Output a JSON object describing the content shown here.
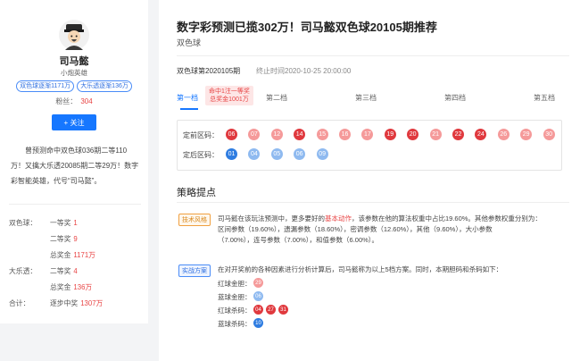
{
  "expert": {
    "name": "司马懿",
    "title": "小炮英雄",
    "tags": [
      "双色球逐渐1171万",
      "大乐透逐渐136万"
    ],
    "fans_label": "粉丝：",
    "fans_count": "304",
    "follow_label": "+ 关注",
    "bio": "曾预测命中双色球036期二等110万！又擒大乐透20085期二等29万！数字彩智能英雄，代号“司马懿”。",
    "stats": [
      {
        "lottery": "双色球：",
        "item": "一等奖",
        "value": "1"
      },
      {
        "lottery": "",
        "item": "二等奖",
        "value": "9"
      },
      {
        "lottery": "",
        "item": "总奖金",
        "value": "1171万"
      },
      {
        "lottery": "大乐透：",
        "item": "二等奖",
        "value": "4"
      },
      {
        "lottery": "",
        "item": "总奖金",
        "value": "136万"
      },
      {
        "lottery": "合计：",
        "item": "逐步中奖",
        "value": "1307万"
      }
    ]
  },
  "header": {
    "title": "数字彩预测已揽302万！司马懿双色球20105期推荐",
    "subtitle": "双色球",
    "period": "双色球第2020105期",
    "end_time": "终止时间2020-10-25 20:00:00"
  },
  "tabs": [
    {
      "label": "第一档",
      "active": true
    },
    {
      "label": "第二档",
      "active": false
    },
    {
      "label": "第三档",
      "active": false
    },
    {
      "label": "第四档",
      "active": false
    },
    {
      "label": "第五档",
      "active": false
    }
  ],
  "badge": {
    "line1": "命中1注一等奖",
    "line2": "总奖金1001万"
  },
  "front_zone": {
    "label": "定前区码：",
    "balls": [
      {
        "n": "06",
        "strong": true
      },
      {
        "n": "07",
        "strong": false
      },
      {
        "n": "12",
        "strong": false
      },
      {
        "n": "14",
        "strong": true
      },
      {
        "n": "15",
        "strong": false
      },
      {
        "n": "16",
        "strong": false
      },
      {
        "n": "17",
        "strong": false
      },
      {
        "n": "19",
        "strong": true
      },
      {
        "n": "20",
        "strong": true
      },
      {
        "n": "21",
        "strong": false
      },
      {
        "n": "22",
        "strong": true
      },
      {
        "n": "24",
        "strong": true
      },
      {
        "n": "26",
        "strong": false
      },
      {
        "n": "29",
        "strong": false
      },
      {
        "n": "30",
        "strong": false
      }
    ]
  },
  "back_zone": {
    "label": "定后区码：",
    "balls": [
      {
        "n": "01",
        "strong": true
      },
      {
        "n": "04",
        "strong": false
      },
      {
        "n": "05",
        "strong": false
      },
      {
        "n": "06",
        "strong": false
      },
      {
        "n": "09",
        "strong": false
      }
    ]
  },
  "strategy": {
    "heading": "策略提点",
    "style_tag": "技术风格",
    "style_lines": [
      {
        "pre": "司马懿在该玩法预测中，更多要好的",
        "red": "基本动作",
        "post": "，该参数在他的算法权重中占比19.60%。其他参数权重分别为："
      },
      {
        "pre": "区间参数（19.60%），遗漏参数（18.60%），密调参数（12.60%），其他（9.60%），大小参数",
        "red": "",
        "post": ""
      },
      {
        "pre": "（7.00%），连号参数（7.00%），和值参数（6.00%）。",
        "red": "",
        "post": ""
      }
    ],
    "plan_tag": "实战方案",
    "plan_intro": "在对开奖前的各种因素进行分析计算后，司马懿称为以上5档方案。同时，本期胆码和杀码如下：",
    "plan_rows": [
      {
        "label": "红球金胆：",
        "balls": [
          "29"
        ],
        "kind": "red-light"
      },
      {
        "label": "蓝球金胆：",
        "balls": [
          "06"
        ],
        "kind": "blue-light"
      },
      {
        "label": "红球杀码：",
        "balls": [
          "04",
          "27",
          "31"
        ],
        "kind": "red"
      },
      {
        "label": "蓝球杀码：",
        "balls": [
          "10"
        ],
        "kind": "blue"
      }
    ]
  },
  "colors": {
    "red_strong": "#e0393e",
    "red_light": "#f59a9a",
    "blue_strong": "#2f7de1",
    "blue_light": "#8fbaf0",
    "accent": "#1677ff"
  }
}
